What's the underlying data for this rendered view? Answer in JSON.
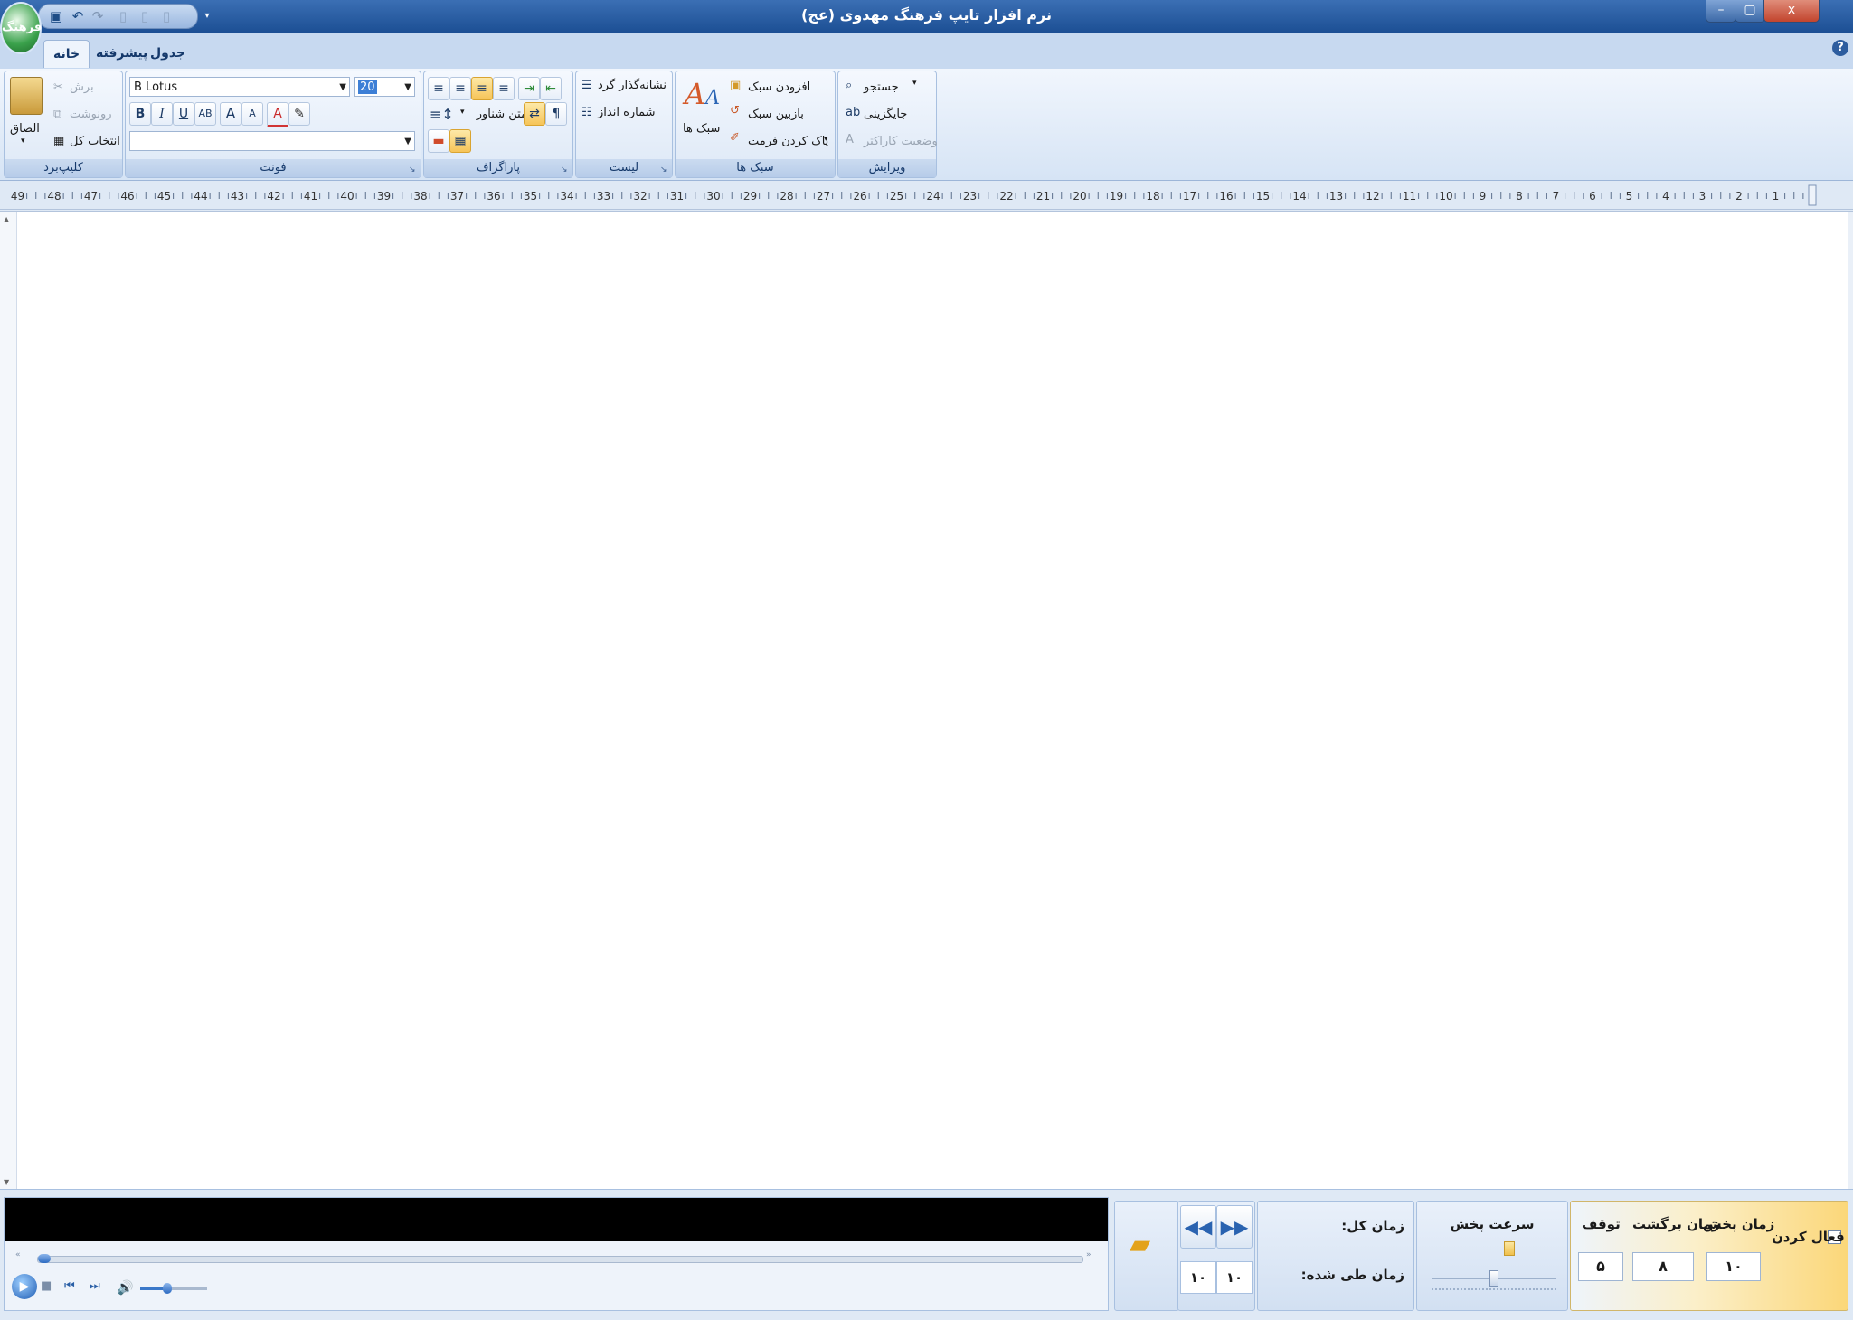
{
  "window": {
    "title": "نرم افزار تایپ فرهنگ مهدوی (عج)",
    "close": "x",
    "maximize": "▢",
    "minimize": "–"
  },
  "app_orb": {
    "text": "فرهنگ"
  },
  "tabs": [
    {
      "label": "خانه",
      "active": true
    },
    {
      "label": "پیشرفته"
    },
    {
      "label": "جدول"
    }
  ],
  "help": "?",
  "ribbon": {
    "clipboard": {
      "caption": "کلیپ‌برد",
      "paste": "الصاق",
      "cut": "برش",
      "copy": "رونوشت",
      "select_all": "انتخاب کل"
    },
    "font": {
      "caption": "فونت",
      "font_name": "B Lotus",
      "font_size": "20",
      "style_value": "",
      "bold": "B",
      "italic": "I",
      "underline": "U",
      "strike": "AB",
      "grow": "A",
      "shrink": "A",
      "color": "A"
    },
    "paragraph": {
      "caption": "پاراگراف",
      "floating_text": "متن شناور",
      "pilcrow": "¶"
    },
    "list": {
      "caption": "لیست",
      "bullets": "نشانه‌گذار گرد",
      "numbering": "شماره انداز"
    },
    "styles": {
      "caption": "سبک ها",
      "styles_button": "سبک ها",
      "add_style": "افزودن سبک",
      "restore_style": "بازبین سبک",
      "clear_format": "پاک کردن فرمت"
    },
    "editing": {
      "caption": "ویرایش",
      "find": "جستجو",
      "replace": "جایگزینی",
      "char_status": "وضعیت کاراکتر"
    }
  },
  "ruler": {
    "min": 1,
    "max": 49
  },
  "player": {
    "progress": 0.0,
    "volume": 0.4,
    "total_time_label": "زمان کل:",
    "elapsed_time_label": "زمان طی شده:",
    "speed_label": "سرعت پخش",
    "speed_value": 0.5,
    "rewind_value": "۱۰",
    "forward_value": "۱۰",
    "settings": {
      "enable_label": "فعال کردن",
      "play_time_label": "زمان پخش",
      "play_time_value": "۱۰",
      "back_time_label": "زمان برگشت",
      "back_time_value": "۸",
      "pause_label": "توقف",
      "pause_value": "۵"
    }
  },
  "colors": {
    "accent": "#1c4f94",
    "highlight": "#f6c458"
  },
  "icons": {
    "play": "play-icon",
    "stop": "stop-icon",
    "prev": "previous-icon",
    "next": "next-icon",
    "volume": "volume-icon",
    "folder": "folder-icon"
  }
}
